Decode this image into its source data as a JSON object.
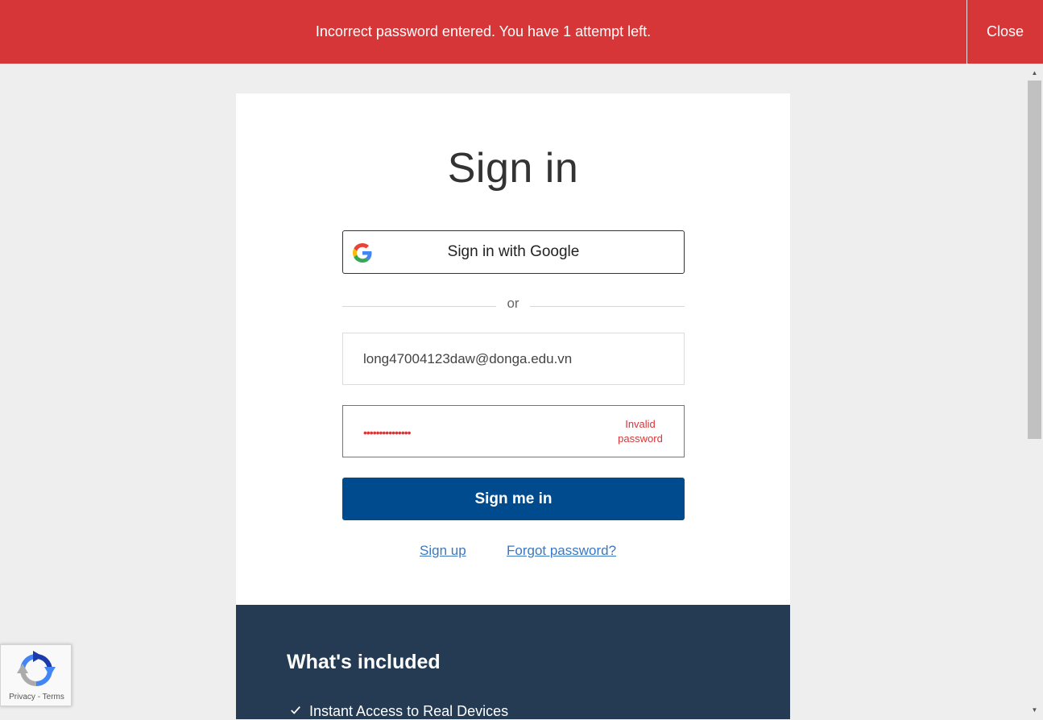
{
  "alert": {
    "message": "Incorrect password entered. You have 1 attempt left.",
    "close_label": "Close",
    "color": "#d63638"
  },
  "form": {
    "title": "Sign in",
    "google_button_label": "Sign in with Google",
    "divider_text": "or",
    "email_value": "long47004123daw@donga.edu.vn",
    "password_masked": "•••••••••••••••",
    "password_error": "Invalid password",
    "submit_label": "Sign me in",
    "signup_link": "Sign up",
    "forgot_link": "Forgot password?",
    "primary_color": "#004b8d"
  },
  "included": {
    "title": "What's included",
    "items": [
      "Instant Access to Real Devices"
    ]
  },
  "recaptcha": {
    "privacy": "Privacy",
    "separator": "-",
    "terms": "Terms"
  },
  "icons": {
    "google": "google-icon",
    "check": "check-icon",
    "recaptcha": "recaptcha-icon"
  }
}
